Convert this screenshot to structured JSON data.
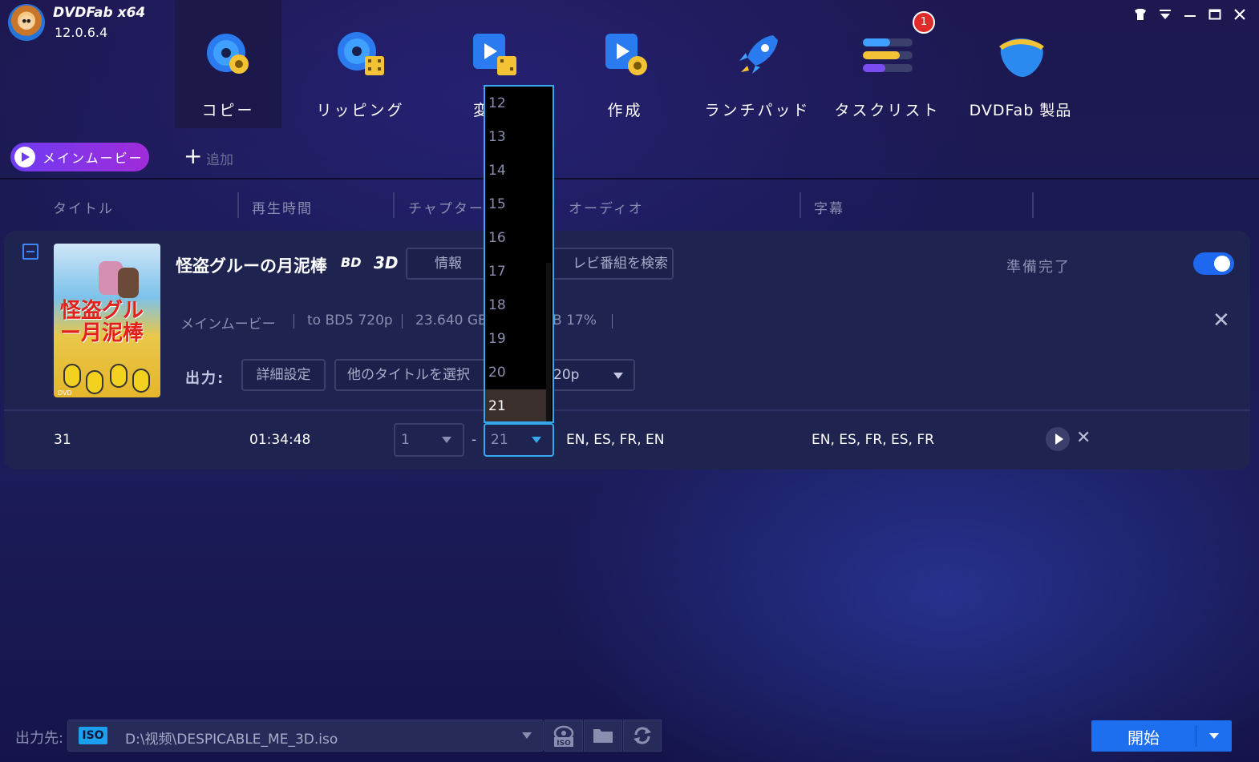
{
  "app": {
    "name": "DVDFab x64",
    "version": "12.0.6.4"
  },
  "nav": {
    "items": [
      {
        "label": "コピー"
      },
      {
        "label": "リッピング"
      },
      {
        "label": "変"
      },
      {
        "label": "作成"
      },
      {
        "label": "ランチパッド"
      },
      {
        "label": "タスクリスト"
      },
      {
        "label": "DVDFab 製品"
      }
    ],
    "badge_count": "1"
  },
  "subbar": {
    "main_movie": "メインムービー",
    "add": "追加"
  },
  "columns": [
    "タイトル",
    "再生時間",
    "チャプター",
    "オーディオ",
    "字幕"
  ],
  "item": {
    "title": "怪盗グルーの月泥棒",
    "bd_logo": "BD",
    "logo_3d": "3D",
    "info_btn": "情報",
    "search_btn": "テレビ番組を検索",
    "search_visible": "レビ番組を検索",
    "status": "準備完了",
    "mode": "メインムービー",
    "profile": "to BD5 720p",
    "size": "23.640 GB",
    "size_tail": "B 17%",
    "output_label": "出力:",
    "detail_btn": "詳細設定",
    "select_title_btn": "他のタイトルを選択",
    "resolution_tail": "20p",
    "poster_text": "怪盗グルー月泥棒",
    "poster_footer": "DVD"
  },
  "row": {
    "title_num": "31",
    "duration": "01:34:48",
    "chapter_start": "1",
    "chapter_dash": "-",
    "chapter_end": "21",
    "audio": "EN, ES, FR, EN",
    "subtitles": "EN, ES, FR, ES, FR"
  },
  "dropdown": {
    "options": [
      "12",
      "13",
      "14",
      "15",
      "16",
      "17",
      "18",
      "19",
      "20",
      "21"
    ],
    "selected": "21"
  },
  "bottom": {
    "dest_label": "出力先:",
    "iso_tag": "ISO",
    "path": "D:\\视频\\DESPICABLE_ME_3D.iso",
    "start": "開始"
  },
  "colors": {
    "accent": "#1e6ef0",
    "focus": "#35a9ef",
    "badge": "#e12b2b"
  }
}
